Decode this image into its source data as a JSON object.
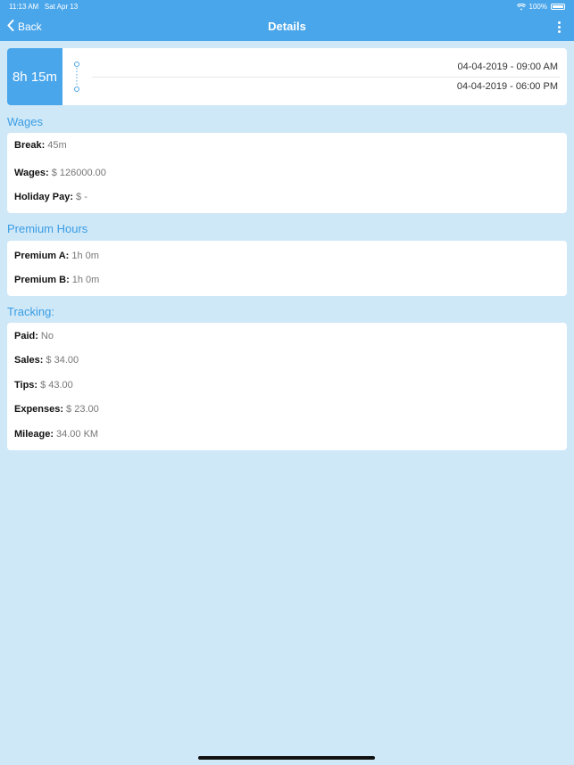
{
  "status_bar": {
    "time": "11:13 AM",
    "date": "Sat Apr 13",
    "battery": "100%"
  },
  "nav": {
    "back_label": "Back",
    "title": "Details"
  },
  "shift": {
    "duration": "8h 15m",
    "start": "04-04-2019 - 09:00 AM",
    "end": "04-04-2019 - 06:00 PM"
  },
  "wages": {
    "title": "Wages",
    "rows": [
      {
        "label": "Break:",
        "value": "45m"
      },
      {
        "label": "Wages:",
        "value": "$ 126000.00"
      },
      {
        "label": "Holiday Pay:",
        "value": "$ -"
      }
    ]
  },
  "premium": {
    "title": "Premium Hours",
    "rows": [
      {
        "label": "Premium A:",
        "value": "1h 0m"
      },
      {
        "label": "Premium B:",
        "value": "1h 0m"
      }
    ]
  },
  "tracking": {
    "title": "Tracking:",
    "rows": [
      {
        "label": "Paid:",
        "value": "No"
      },
      {
        "label": "Sales:",
        "value": "$ 34.00"
      },
      {
        "label": "Tips:",
        "value": "$ 43.00"
      },
      {
        "label": "Expenses:",
        "value": "$ 23.00"
      },
      {
        "label": "Mileage:",
        "value": "34.00 KM"
      }
    ]
  },
  "colors": {
    "accent": "#4aa6ea",
    "background": "#cfe8f8",
    "section_title": "#3a9de3"
  }
}
